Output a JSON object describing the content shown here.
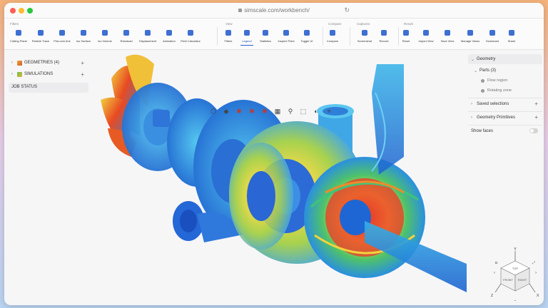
{
  "browser": {
    "url": "simscale.com/workbench/"
  },
  "toolbar": {
    "groups": [
      {
        "label": "Filters",
        "tools": [
          "Cutting Plane",
          "Particle Trace",
          "Plot-over-line",
          "Iso Surface",
          "Iso Volume",
          "Robotcad",
          "Displacement",
          "Animation",
          "Field Calculator"
        ]
      },
      {
        "label": "View",
        "tools": [
          "Filters",
          "Legend",
          "Statistics",
          "Inspect Point",
          "Toggle UI"
        ]
      },
      {
        "label": "Compare",
        "tools": [
          "Compare"
        ]
      },
      {
        "label": "Captures",
        "tools": [
          "Screenshot",
          "Record"
        ]
      },
      {
        "label": "Result",
        "tools": [
          "Reset",
          "Import View",
          "Save View",
          "Manage Views",
          "Download",
          "Share"
        ]
      }
    ],
    "active_tool": "Legend",
    "icon_color": "#3e6fd2"
  },
  "left_panel": {
    "geometries": "GEOMETRIES (4)",
    "simulations": "SIMULATIONS",
    "job_status": "JOB STATUS"
  },
  "right_panel": {
    "geometry": "Geometry",
    "parts": "Parts (3)",
    "part_items": [
      "Flow region",
      "Rotating zone"
    ],
    "saved_selections": "Saved selections",
    "geometry_primitives": "Geometry Primitives",
    "show_faces": "Show faces",
    "show_faces_on": false
  },
  "view_cube": {
    "faces": [
      "TOP",
      "FRONT",
      "RIGHT"
    ],
    "axes": [
      "Y",
      "X",
      "Z"
    ]
  }
}
